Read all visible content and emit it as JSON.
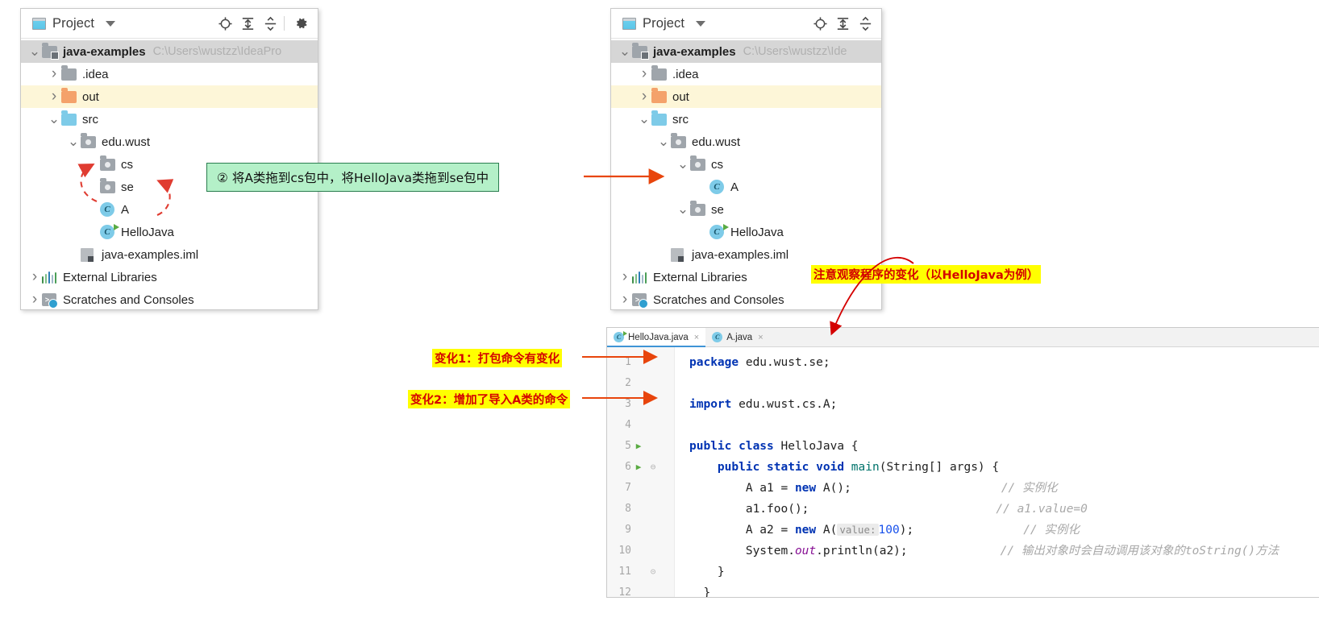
{
  "panel_left": {
    "header": {
      "window_icon": "project-window-icon",
      "title": "Project",
      "dropdown_icon": "caret-down-icon",
      "icons": [
        "locate-target-icon",
        "expand-all-icon",
        "collapse-all-icon",
        "gear-icon"
      ]
    },
    "tree": [
      {
        "label": "java-examples",
        "hint": "C:\\Users\\wustzz\\IdeaPro",
        "icon": "module-folder-icon",
        "twisty": "v",
        "depth": 0,
        "bold": true,
        "state": "sel-grey"
      },
      {
        "label": ".idea",
        "hint": "",
        "icon": "grey-folder-icon",
        "twisty": ">",
        "depth": 1,
        "bold": false,
        "state": ""
      },
      {
        "label": "out",
        "hint": "",
        "icon": "orange-folder-icon",
        "twisty": ">",
        "depth": 1,
        "bold": false,
        "state": "sel-yellow"
      },
      {
        "label": "src",
        "hint": "",
        "icon": "blue-folder-icon",
        "twisty": "v",
        "depth": 1,
        "bold": false,
        "state": ""
      },
      {
        "label": "edu.wust",
        "hint": "",
        "icon": "package-icon",
        "twisty": "v",
        "depth": 2,
        "bold": false,
        "state": ""
      },
      {
        "label": "cs",
        "hint": "",
        "icon": "package-icon",
        "twisty": "",
        "depth": 3,
        "bold": false,
        "state": ""
      },
      {
        "label": "se",
        "hint": "",
        "icon": "package-icon",
        "twisty": "",
        "depth": 3,
        "bold": false,
        "state": ""
      },
      {
        "label": "A",
        "hint": "",
        "icon": "java-class-icon",
        "twisty": "",
        "depth": 3,
        "bold": false,
        "state": ""
      },
      {
        "label": "HelloJava",
        "hint": "",
        "icon": "java-class-runnable-icon",
        "twisty": "",
        "depth": 3,
        "bold": false,
        "state": ""
      },
      {
        "label": "java-examples.iml",
        "hint": "",
        "icon": "iml-file-icon",
        "twisty": "",
        "depth": 2,
        "bold": false,
        "state": ""
      },
      {
        "label": "External Libraries",
        "hint": "",
        "icon": "libraries-icon",
        "twisty": ">",
        "depth": 0,
        "bold": false,
        "state": ""
      },
      {
        "label": "Scratches and Consoles",
        "hint": "",
        "icon": "scratches-icon",
        "twisty": ">",
        "depth": 0,
        "bold": false,
        "state": ""
      }
    ]
  },
  "panel_right": {
    "header": {
      "window_icon": "project-window-icon",
      "title": "Project",
      "dropdown_icon": "caret-down-icon",
      "icons": [
        "locate-target-icon",
        "expand-all-icon",
        "collapse-all-icon"
      ]
    },
    "tree": [
      {
        "label": "java-examples",
        "hint": "C:\\Users\\wustzz\\Ide",
        "icon": "module-folder-icon",
        "twisty": "v",
        "depth": 0,
        "bold": true,
        "state": "sel-grey"
      },
      {
        "label": ".idea",
        "hint": "",
        "icon": "grey-folder-icon",
        "twisty": ">",
        "depth": 1,
        "bold": false,
        "state": ""
      },
      {
        "label": "out",
        "hint": "",
        "icon": "orange-folder-icon",
        "twisty": ">",
        "depth": 1,
        "bold": false,
        "state": "sel-yellow"
      },
      {
        "label": "src",
        "hint": "",
        "icon": "blue-folder-icon",
        "twisty": "v",
        "depth": 1,
        "bold": false,
        "state": ""
      },
      {
        "label": "edu.wust",
        "hint": "",
        "icon": "package-icon",
        "twisty": "v",
        "depth": 2,
        "bold": false,
        "state": ""
      },
      {
        "label": "cs",
        "hint": "",
        "icon": "package-icon",
        "twisty": "v",
        "depth": 3,
        "bold": false,
        "state": ""
      },
      {
        "label": "A",
        "hint": "",
        "icon": "java-class-icon",
        "twisty": "",
        "depth": 4,
        "bold": false,
        "state": ""
      },
      {
        "label": "se",
        "hint": "",
        "icon": "package-icon",
        "twisty": "v",
        "depth": 3,
        "bold": false,
        "state": ""
      },
      {
        "label": "HelloJava",
        "hint": "",
        "icon": "java-class-runnable-icon",
        "twisty": "",
        "depth": 4,
        "bold": false,
        "state": ""
      },
      {
        "label": "java-examples.iml",
        "hint": "",
        "icon": "iml-file-icon",
        "twisty": "",
        "depth": 2,
        "bold": false,
        "state": ""
      },
      {
        "label": "External Libraries",
        "hint": "",
        "icon": "libraries-icon",
        "twisty": ">",
        "depth": 0,
        "bold": false,
        "state": ""
      },
      {
        "label": "Scratches and Consoles",
        "hint": "",
        "icon": "scratches-icon",
        "twisty": ">",
        "depth": 0,
        "bold": false,
        "state": ""
      }
    ]
  },
  "annotations": {
    "step2": "② 将A类拖到cs包中，将HelloJava类拖到se包中",
    "observe": "注意观察程序的变化（以HelloJava为例）",
    "change1": "变化1：打包命令有变化",
    "change2": "变化2：增加了导入A类的命令"
  },
  "editor": {
    "tabs": [
      {
        "label": "HelloJava.java",
        "icon": "java-class-runnable-icon",
        "active": true,
        "close": "×"
      },
      {
        "label": "A.java",
        "icon": "java-class-icon",
        "active": false,
        "close": "×"
      }
    ],
    "lines": [
      {
        "n": "1",
        "run": "",
        "fold": ""
      },
      {
        "n": "2",
        "run": "",
        "fold": ""
      },
      {
        "n": "3",
        "run": "",
        "fold": ""
      },
      {
        "n": "4",
        "run": "",
        "fold": ""
      },
      {
        "n": "5",
        "run": "▶",
        "fold": ""
      },
      {
        "n": "6",
        "run": "▶",
        "fold": "⊖"
      },
      {
        "n": "7",
        "run": "",
        "fold": ""
      },
      {
        "n": "8",
        "run": "",
        "fold": ""
      },
      {
        "n": "9",
        "run": "",
        "fold": ""
      },
      {
        "n": "10",
        "run": "",
        "fold": ""
      },
      {
        "n": "11",
        "run": "",
        "fold": "⊝"
      },
      {
        "n": "12",
        "run": "",
        "fold": ""
      }
    ],
    "code": {
      "l1_kw": "package",
      "l1_rest": " edu.wust.se;",
      "l3_kw": "import",
      "l3_rest": " edu.wust.cs.A;",
      "l5_a": "public class ",
      "l5_b": "HelloJava {",
      "l6_a": "    public static void ",
      "l6_b": "main",
      "l6_c": "(String[] args) {",
      "l7_a": "        A a1 = ",
      "l7_b": "new",
      "l7_c": " A();",
      "l7_cmt": "// 实例化",
      "l8_a": "        a1.foo();",
      "l8_cmt": "// a1.value=0",
      "l9_a": "        A a2 = ",
      "l9_b": "new",
      "l9_c": " A(",
      "l9_hint": "value:",
      "l9_num": "100",
      "l9_d": ");",
      "l9_cmt": "// 实例化",
      "l10_a": "        System.",
      "l10_b": "out",
      "l10_c": ".println(a2);",
      "l10_cmt": "// 输出对象时会自动调用该对象的toString()方法",
      "l11": "    }",
      "l12": "  }"
    }
  },
  "colors": {
    "accent_blue": "#3f94d6",
    "annotation_red": "#e03c31",
    "annotation_orange": "#e8450c",
    "highlight_yellow": "#ffff00",
    "callout_green": "#b4f0c8",
    "selection_grey": "#d6d6d6",
    "selection_yellow": "#fdf6d8"
  }
}
